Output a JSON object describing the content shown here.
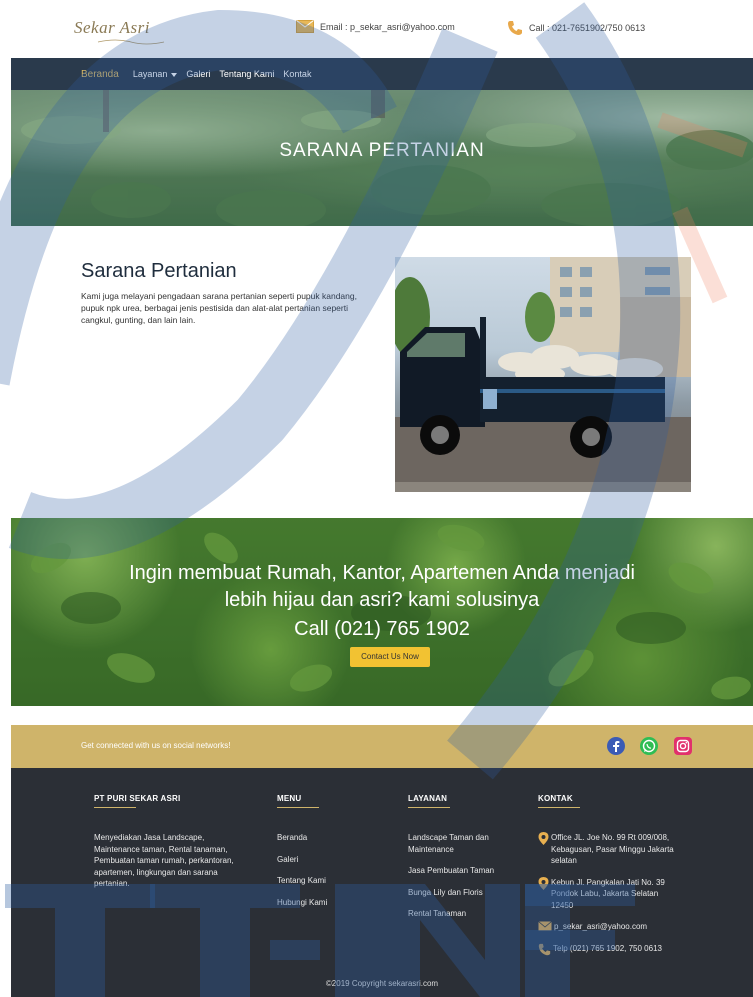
{
  "header": {
    "logo_text": "Sekar Asri",
    "email_text": "Email : p_sekar_asri@yahoo.com",
    "call_text": "Call : 021-7651902/750 0613"
  },
  "nav": {
    "items": [
      "Beranda",
      "Layanan",
      "Galeri",
      "Tentang Kami",
      "Kontak"
    ]
  },
  "hero": {
    "title": "SARANA PERTANIAN"
  },
  "content": {
    "title": "Sarana Pertanian",
    "body": "Kami juga melayani pengadaan sarana pertanian seperti pupuk kandang, pupuk npk urea, berbagai jenis pestisida dan alat-alat pertanian seperti cangkul, gunting, dan lain lain."
  },
  "cta": {
    "line1": "Ingin membuat Rumah, Kantor, Apartemen Anda menjadi",
    "line2": "lebih hijau dan asri? kami solusinya",
    "phone": "Call (021) 765 1902",
    "button": "Contact Us Now"
  },
  "social": {
    "text": "Get connected with us on social networks!",
    "icons": [
      "facebook-icon",
      "whatsapp-icon",
      "instagram-icon"
    ]
  },
  "footer": {
    "company": {
      "heading": "PT PURI SEKAR ASRI",
      "body": "Menyediakan Jasa Landscape, Maintenance taman, Rental tanaman, Pembuatan taman rumah, perkantoran, apartemen, lingkungan dan sarana pertanian."
    },
    "menu": {
      "heading": "MENU",
      "items": [
        "Beranda",
        "Galeri",
        "Tentang Kami",
        "Hubungi Kami"
      ]
    },
    "layanan": {
      "heading": "LAYANAN",
      "items": [
        "Landscape Taman dan Maintenance",
        "Jasa Pembuatan Taman",
        "Bunga Lily dan Floris",
        "Rental Tanaman"
      ]
    },
    "kontak": {
      "heading": "KONTAK",
      "office": "Office JL. Joe No. 99 Rt 009/008, Kebagusan, Pasar Minggu Jakarta selatan",
      "kebun": "Kebun Jl. Pangkalan Jati No. 39 Pondok Labu, Jakarta Selatan 12450",
      "email": "p_sekar_asri@yahoo.com",
      "telp": "Telp (021) 765 1902, 750 0613"
    },
    "copyright": "©2019 Copyright sekarasri.com"
  },
  "colors": {
    "navbar": "#2a3a4c",
    "gold": "#cfb46a",
    "footer": "#2b2f36",
    "button": "#f2c232"
  }
}
